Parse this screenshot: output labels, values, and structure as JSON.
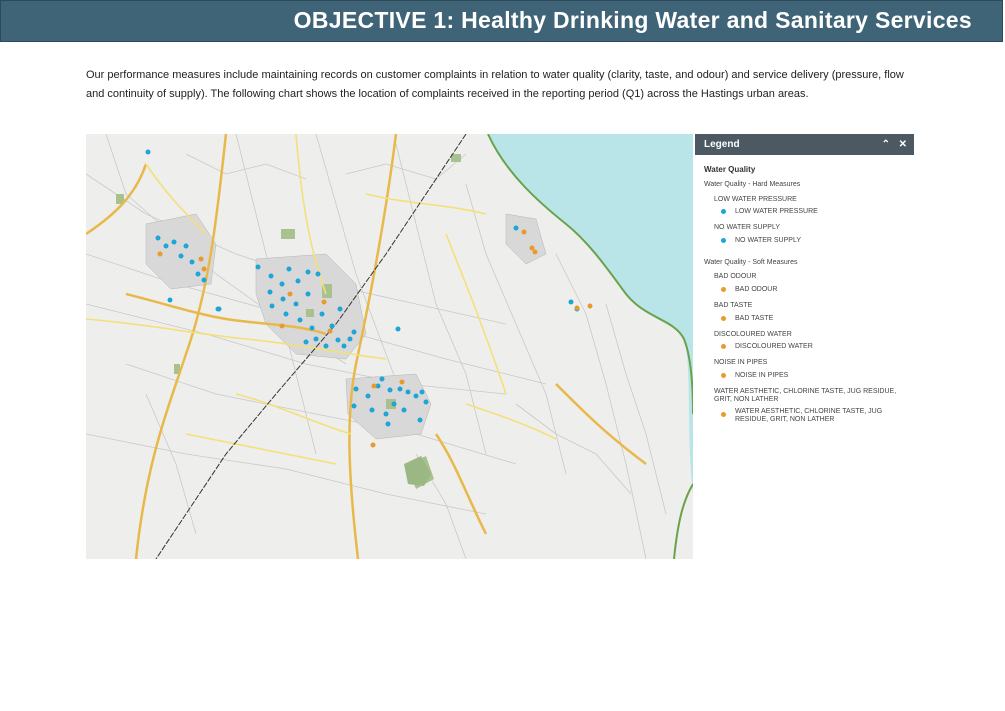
{
  "header": {
    "title": "OBJECTIVE 1: Healthy Drinking Water and Sanitary Services"
  },
  "intro": {
    "text": "Our performance measures include maintaining records on customer complaints in relation to water quality (clarity, taste, and odour) and service delivery (pressure, flow and continuity of supply). The following chart shows the location of complaints received in the reporting period (Q1) across the Hastings urban areas."
  },
  "colors": {
    "banner": "#3f6478",
    "sea": "#b9e5e8",
    "blue_marker": "#1ea5d6",
    "orange_marker": "#e89a2c",
    "road_major": "#e8b94a",
    "road_minor": "#f4e07a",
    "park": "#a9c08f"
  },
  "legend": {
    "title": "Legend",
    "collapse_icon": "double-chevron-up-icon",
    "close_icon": "close-icon",
    "group": "Water Quality",
    "sections": [
      {
        "heading": "Water Quality - Hard Measures",
        "categories": [
          {
            "name": "LOW WATER PRESSURE",
            "item": "LOW WATER PRESSURE",
            "color": "#1ea5d6"
          },
          {
            "name": "NO WATER SUPPLY",
            "item": "NO WATER SUPPLY",
            "color": "#1ea5d6"
          }
        ]
      },
      {
        "heading": "Water Quality - Soft Measures",
        "categories": [
          {
            "name": "BAD ODOUR",
            "item": "BAD ODOUR",
            "color": "#e89a2c"
          },
          {
            "name": "BAD TASTE",
            "item": "BAD TASTE",
            "color": "#e89a2c"
          },
          {
            "name": "DISCOLOURED WATER",
            "item": "DISCOLOURED WATER",
            "color": "#e89a2c"
          },
          {
            "name": "NOISE IN PIPES",
            "item": "NOISE IN PIPES",
            "color": "#e89a2c"
          },
          {
            "name": "WATER AESTHETIC, CHLORINE TASTE, JUG RESIDUE, GRIT, NON LATHER",
            "item": "WATER AESTHETIC, CHLORINE TASTE, JUG RESIDUE, GRIT, NON LATHER",
            "color": "#e89a2c"
          }
        ]
      }
    ]
  }
}
